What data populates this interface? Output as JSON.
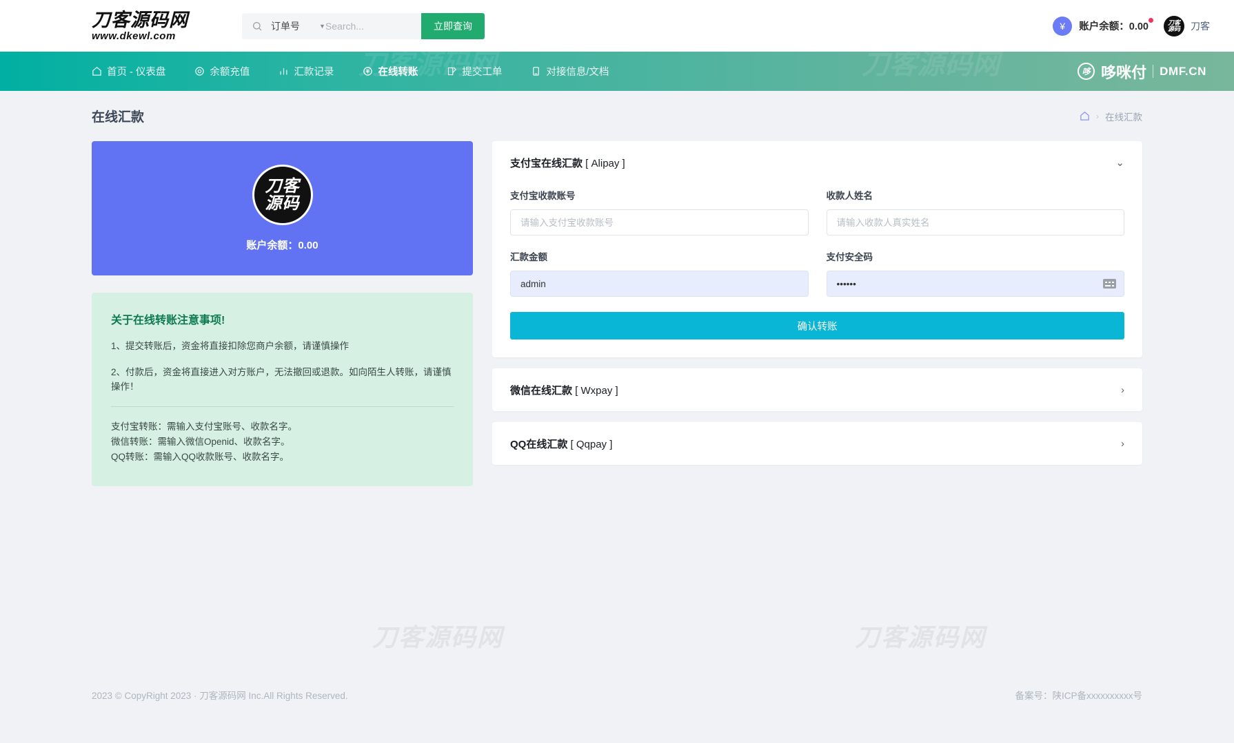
{
  "topbar": {
    "brand_main": "刀客源码网",
    "brand_sub": "www.dkewl.com",
    "search": {
      "icon": "search-icon",
      "selected_option": "订单号",
      "placeholder": "Search...",
      "button_label": "立即查询"
    },
    "balance": {
      "currency_icon": "¥",
      "label": "账户余额：0.00",
      "has_alert_dot": true
    },
    "user": {
      "avatar_line1": "刀客",
      "avatar_line2": "源码",
      "name": "刀客"
    }
  },
  "nav": {
    "watermark": "刀客源码网",
    "items": [
      {
        "label": "首页 - 仪表盘",
        "icon": "home-icon",
        "active": false
      },
      {
        "label": "余额充值",
        "icon": "target-icon",
        "active": false
      },
      {
        "label": "汇款记录",
        "icon": "bar-chart-icon",
        "active": false
      },
      {
        "label": "在线转账",
        "icon": "coin-icon",
        "active": true
      },
      {
        "label": "提交工单",
        "icon": "edit-icon",
        "active": false
      },
      {
        "label": "对接信息/文档",
        "icon": "book-icon",
        "active": false
      }
    ],
    "logo": {
      "mark": "哆",
      "cn": "哆咪付",
      "en": "DMF.CN"
    }
  },
  "page": {
    "title": "在线汇款",
    "breadcrumb": {
      "home_icon": "home-icon",
      "separator": "›",
      "current": "在线汇款"
    }
  },
  "balance_card": {
    "logo_line1": "刀客",
    "logo_line2": "源码",
    "text": "账户余额：0.00"
  },
  "notice": {
    "heading": "关于在线转账注意事项!",
    "items": [
      "1、提交转账后，资金将直接扣除您商户余额，请谨慎操作",
      "2、付款后，资金将直接进入对方账户，无法撤回或退款。如向陌生人转账，请谨慎操作！"
    ],
    "sub_lines": [
      "支付宝转账：需输入支付宝账号、收款名字。",
      "微信转账：需输入微信Openid、收款名字。",
      "QQ转账：需输入QQ收款账号、收款名字。"
    ]
  },
  "panels": {
    "alipay": {
      "title_cn": "支付宝在线汇款",
      "title_en": " [ Alipay ]",
      "expanded": true,
      "chevron": "chevron-down-icon",
      "fields": {
        "account": {
          "label": "支付宝收款账号",
          "placeholder": "请输入支付宝收款账号",
          "value": ""
        },
        "payee": {
          "label": "收款人姓名",
          "placeholder": "请输入收款人真实姓名",
          "value": ""
        },
        "amount": {
          "label": "汇款金额",
          "placeholder": "",
          "value": "admin"
        },
        "paycode": {
          "label": "支付安全码",
          "placeholder": "",
          "value": "••••••",
          "icon": "keyboard-icon"
        }
      },
      "submit_label": "确认转账"
    },
    "wxpay": {
      "title_cn": "微信在线汇款",
      "title_en": " [ Wxpay ]",
      "expanded": false,
      "chevron": "chevron-right-icon"
    },
    "qqpay": {
      "title_cn": "QQ在线汇款",
      "title_en": " [ Qqpay ]",
      "expanded": false,
      "chevron": "chevron-right-icon"
    }
  },
  "watermarks": {
    "left": "刀客源码网",
    "right": "刀客源码网"
  },
  "footer": {
    "copyright": "2023 © CopyRight 2023 · 刀客源码网 Inc.All Rights Reserved.",
    "icp": "备案号：陕ICP备xxxxxxxxxx号"
  },
  "colors": {
    "nav_start": "#00b0a2",
    "nav_end": "#78b79c",
    "search_button": "#22ab6e",
    "balance_card": "#6173f3",
    "submit_button": "#0ab6d6",
    "notice_bg": "#d6f0e4",
    "notice_heading": "#0d7a50",
    "alert_dot": "#f1315f",
    "yuan_badge": "#6b7cf6"
  }
}
